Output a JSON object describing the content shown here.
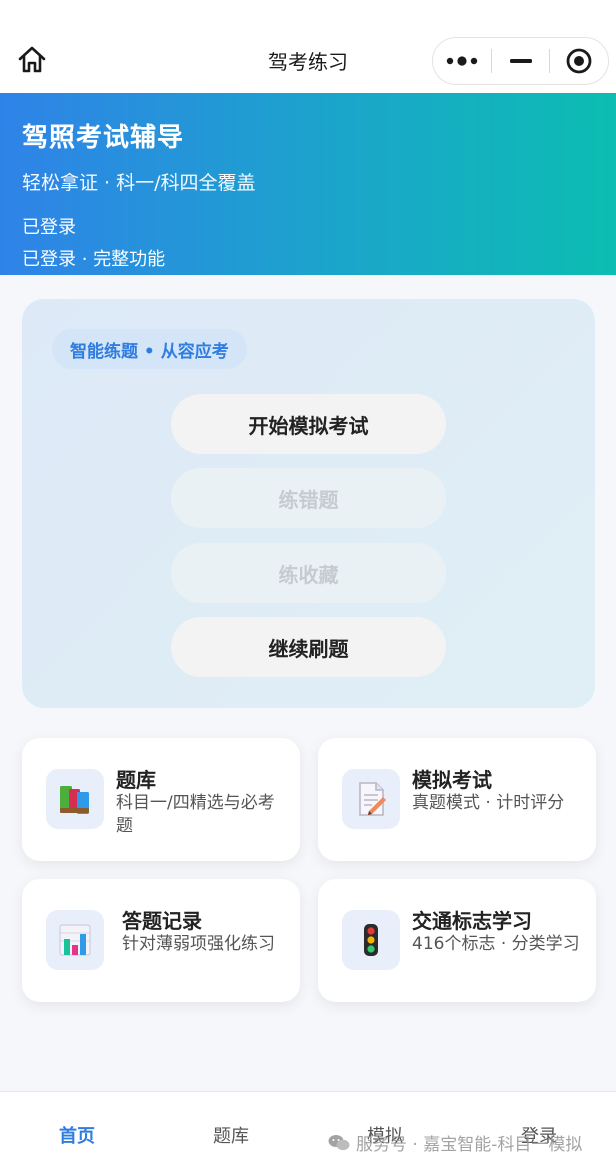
{
  "nav": {
    "title": "驾考练习",
    "home_icon": "home-icon",
    "more_icon": "more-dots-icon",
    "minimize_icon": "minimize-icon",
    "close_icon": "target-close-icon"
  },
  "banner": {
    "title": "驾照考试辅导",
    "subtitle": "轻松拿证 · 科一/科四全覆盖",
    "status": "已登录",
    "status_detail": "已登录 · 完整功能",
    "gradient_start": "#2f83e8",
    "gradient_end": "#0cbdb2"
  },
  "practice": {
    "badge": "智能练题 • 从容应考",
    "buttons": [
      {
        "label": "开始模拟考试",
        "enabled": true
      },
      {
        "label": "练错题",
        "enabled": false
      },
      {
        "label": "练收藏",
        "enabled": false
      },
      {
        "label": "继续刷题",
        "enabled": true
      }
    ]
  },
  "features": [
    {
      "title": "题库",
      "desc": "科目一/四精选与必考题",
      "icon": "books-icon"
    },
    {
      "title": "模拟考试",
      "desc": "真题模式 · 计时评分",
      "icon": "exam-paper-icon"
    },
    {
      "title": "答题记录",
      "desc": "针对薄弱项强化练习",
      "icon": "bar-chart-icon"
    },
    {
      "title": "交通标志学习",
      "desc": "416个标志 · 分类学习",
      "icon": "traffic-light-icon"
    }
  ],
  "tabbar": {
    "items": [
      {
        "label": "首页",
        "active": true
      },
      {
        "label": "题库",
        "active": false
      },
      {
        "label": "模拟",
        "active": false
      },
      {
        "label": "登录",
        "active": false
      }
    ]
  },
  "watermark": "服务号 · 嘉宝智能-科目一模拟",
  "colors": {
    "accent": "#2f7de0",
    "background": "#f6f7fb"
  }
}
